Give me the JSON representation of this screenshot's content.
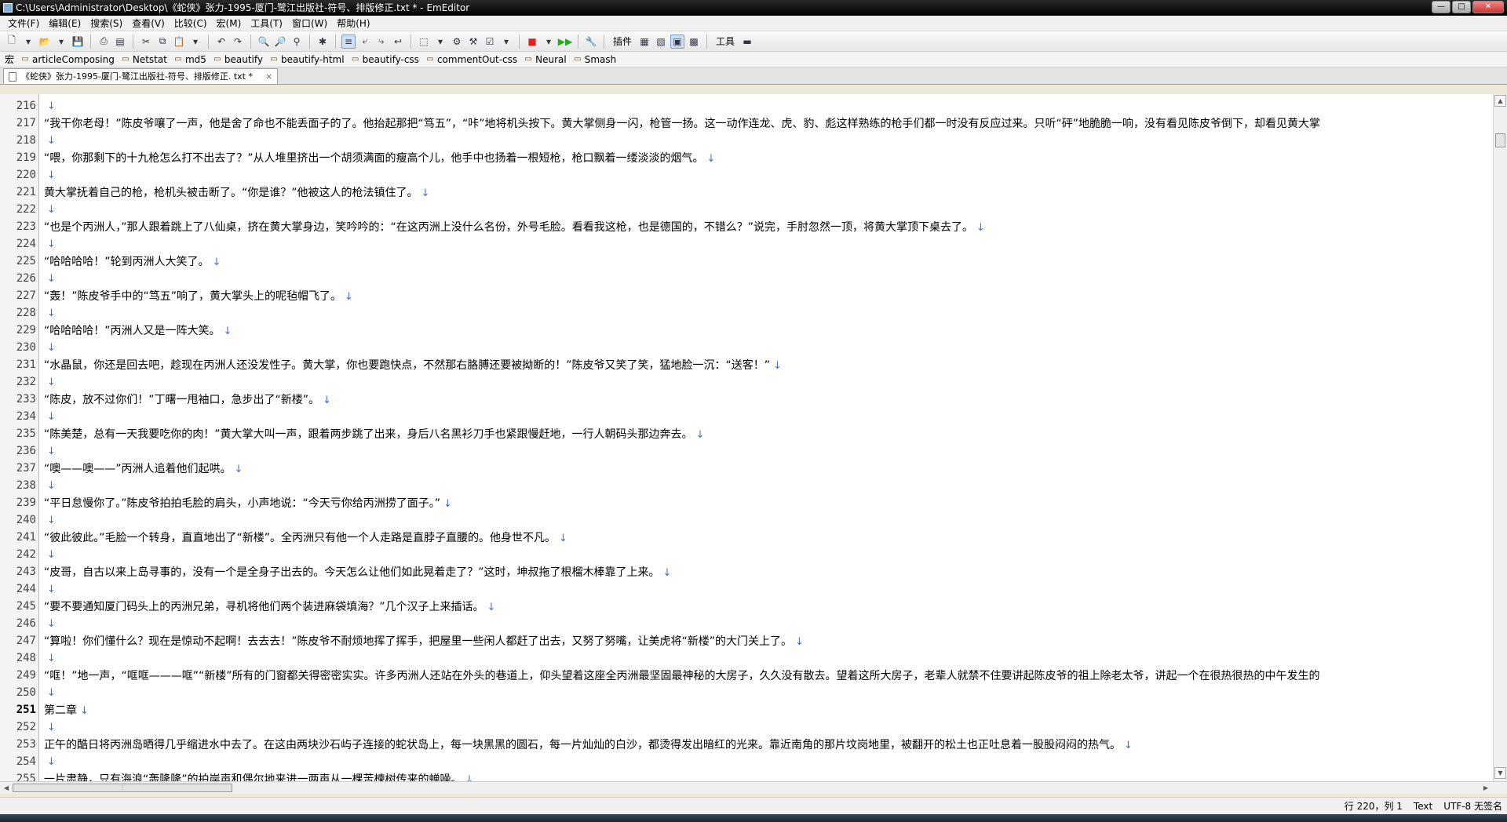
{
  "window": {
    "title": "C:\\Users\\Administrator\\Desktop\\《蛇侠》张力-1995-厦门-鹭江出版社-符号、排版修正.txt * - EmEditor",
    "minimize": "—",
    "maximize": "□",
    "close": "✕"
  },
  "menu": [
    "文件(F)",
    "编辑(E)",
    "搜索(S)",
    "查看(V)",
    "比较(C)",
    "宏(M)",
    "工具(T)",
    "窗口(W)",
    "帮助(H)"
  ],
  "toolbar": {
    "plugins_label": "插件",
    "tools_label": "工具"
  },
  "macrobar": {
    "label": "宏",
    "items": [
      "articleComposing",
      "Netstat",
      "md5",
      "beautify",
      "beautify-html",
      "beautify-css",
      "commentOut-css",
      "Neural",
      "Smash"
    ]
  },
  "tab": {
    "label": "《蛇侠》张力-1995-厦门-鹭江出版社-符号、排版修正. txt *",
    "close": "×"
  },
  "editor": {
    "eol": "↓",
    "lines": [
      {
        "n": "216",
        "t": ""
      },
      {
        "n": "217",
        "t": "“我干你老母！”陈皮爷嚷了一声，他是舍了命也不能丢面子的了。他抬起那把“笃五”，“咔”地将机头按下。黄大掌侧身一闪，枪管一扬。这一动作连龙、虎、豹、彪这样熟练的枪手们都一时没有反应过来。只听“砰”地脆脆一响，没有看见陈皮爷倒下，却看见黄大掌"
      },
      {
        "n": "218",
        "t": ""
      },
      {
        "n": "219",
        "t": "“喂，你那剩下的十九枪怎么打不出去了？”从人堆里挤出一个胡须满面的瘦高个儿，他手中也扬着一根短枪，枪口飘着一缕淡淡的烟气。"
      },
      {
        "n": "220",
        "t": ""
      },
      {
        "n": "221",
        "t": "黄大掌抚着自己的枪，枪机头被击断了。“你是谁？”他被这人的枪法镇住了。"
      },
      {
        "n": "222",
        "t": ""
      },
      {
        "n": "223",
        "t": "“也是个丙洲人，”那人跟着跳上了八仙桌，挤在黄大掌身边，笑吟吟的：“在这丙洲上没什么名份，外号毛脸。看看我这枪，也是德国的，不错么？”说完，手肘忽然一顶，将黄大掌顶下桌去了。"
      },
      {
        "n": "224",
        "t": ""
      },
      {
        "n": "225",
        "t": "“哈哈哈哈！”轮到丙洲人大笑了。"
      },
      {
        "n": "226",
        "t": ""
      },
      {
        "n": "227",
        "t": "“轰！”陈皮爷手中的“笃五”响了，黄大掌头上的呢毡帽飞了。"
      },
      {
        "n": "228",
        "t": ""
      },
      {
        "n": "229",
        "t": "“哈哈哈哈！”丙洲人又是一阵大笑。"
      },
      {
        "n": "230",
        "t": ""
      },
      {
        "n": "231",
        "t": "“水晶鼠，你还是回去吧，趁现在丙洲人还没发性子。黄大掌，你也要跑快点，不然那右胳膊还要被拗断的！”陈皮爷又笑了笑，猛地脸一沉：“送客！”"
      },
      {
        "n": "232",
        "t": ""
      },
      {
        "n": "233",
        "t": "“陈皮，放不过你们！”丁曙一甩袖口，急步出了“新楼”。"
      },
      {
        "n": "234",
        "t": ""
      },
      {
        "n": "235",
        "t": "“陈美楚，总有一天我要吃你的肉！”黄大掌大叫一声，跟着两步跳了出来，身后八名黑衫刀手也紧跟慢赶地，一行人朝码头那边奔去。"
      },
      {
        "n": "236",
        "t": ""
      },
      {
        "n": "237",
        "t": "“噢——噢——”丙洲人追着他们起哄。"
      },
      {
        "n": "238",
        "t": ""
      },
      {
        "n": "239",
        "t": "“平日怠慢你了。”陈皮爷拍拍毛脸的肩头，小声地说：“今天亏你给丙洲捞了面子。”"
      },
      {
        "n": "240",
        "t": ""
      },
      {
        "n": "241",
        "t": "“彼此彼此。”毛脸一个转身，直直地出了“新楼”。全丙洲只有他一个人走路是直脖子直腰的。他身世不凡。"
      },
      {
        "n": "242",
        "t": ""
      },
      {
        "n": "243",
        "t": "“皮哥，自古以来上岛寻事的，没有一个是全身子出去的。今天怎么让他们如此晃着走了？”这时，坤叔拖了根榴木棒靠了上来。"
      },
      {
        "n": "244",
        "t": ""
      },
      {
        "n": "245",
        "t": "“要不要通知厦门码头上的丙洲兄弟，寻机将他们两个装进麻袋填海？”几个汉子上来插话。"
      },
      {
        "n": "246",
        "t": ""
      },
      {
        "n": "247",
        "t": "“算啦！你们懂什么？现在是惊动不起啊！去去去！”陈皮爷不耐烦地挥了挥手，把屋里一些闲人都赶了出去，又努了努嘴，让美虎将“新楼”的大门关上了。"
      },
      {
        "n": "248",
        "t": ""
      },
      {
        "n": "249",
        "t": "“哐！”地一声，“哐哐———哐”“新楼”所有的门窗都关得密密实实。许多丙洲人还站在外头的巷道上，仰头望着这座全丙洲最坚固最神秘的大房子，久久没有散去。望着这所大房子，老辈人就禁不住要讲起陈皮爷的祖上除老太爷，讲起一个在很热很热的中午发生的"
      },
      {
        "n": "250",
        "t": ""
      },
      {
        "n": "251",
        "t": "第二章"
      },
      {
        "n": "252",
        "t": ""
      },
      {
        "n": "253",
        "t": "正午的酷日将丙洲岛晒得几乎缩进水中去了。在这由两块沙石屿子连接的蛇状岛上，每一块黑黑的圆石，每一片灿灿的白沙，都烫得发出暗红的光来。靠近南角的那片坟岗地里，被翻开的松土也正吐息着一股股闷闷的热气。"
      },
      {
        "n": "254",
        "t": ""
      },
      {
        "n": "255",
        "t": "一片肃静，只有海浪“轰隆隆”的拍岸声和偶尔地来进一两声从一棵苦楝树传来的蝉噪。"
      }
    ]
  },
  "status": {
    "position": "行 220，列 1",
    "mode": "Text",
    "encoding": "UTF-8 无签名"
  }
}
